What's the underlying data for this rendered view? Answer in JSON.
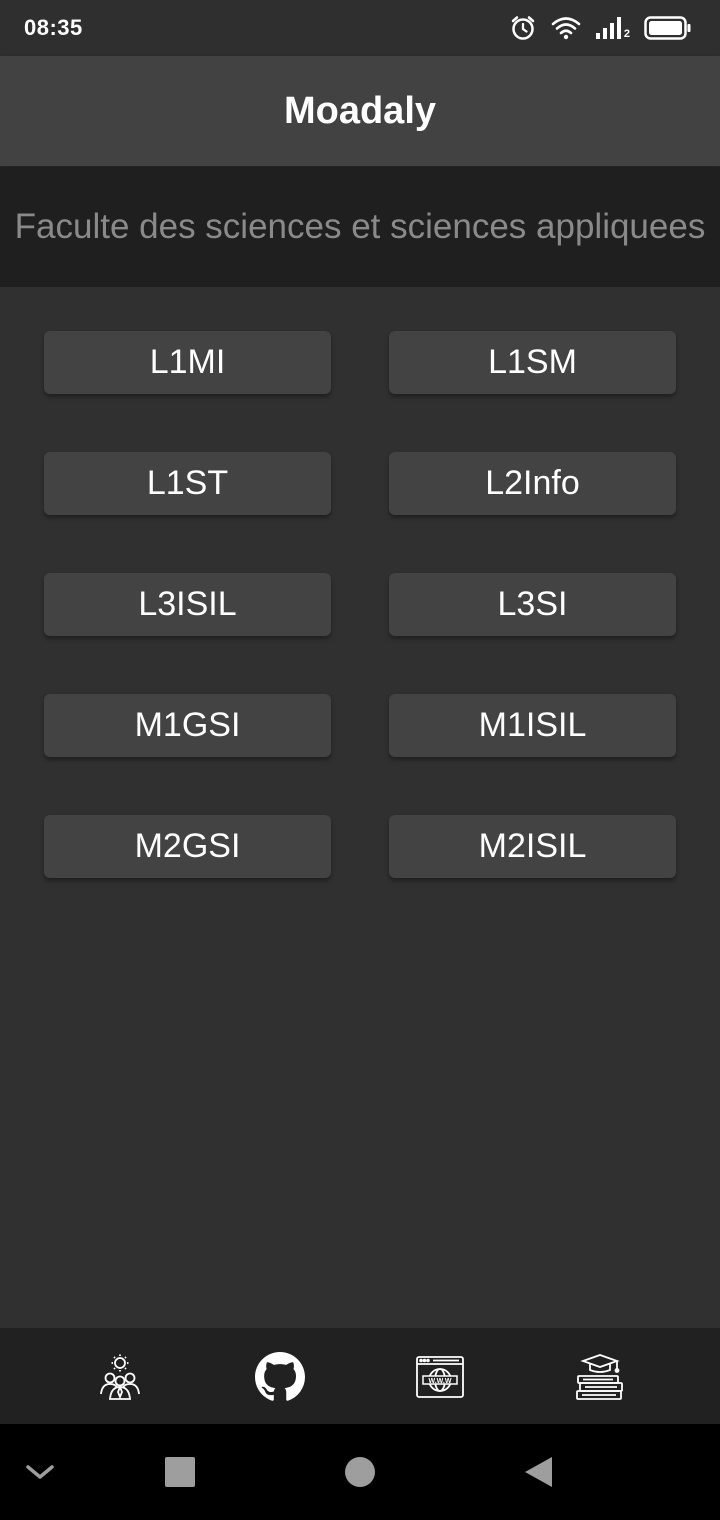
{
  "status_bar": {
    "time": "08:35",
    "signal_sub": "2",
    "icons": [
      "alarm-icon",
      "wifi-icon",
      "signal-icon",
      "battery-icon"
    ]
  },
  "app_bar": {
    "title": "Moadaly"
  },
  "faculty": {
    "name": "Faculte des sciences et sciences appliquees"
  },
  "levels": [
    "L1MI",
    "L1SM",
    "L1ST",
    "L2Info",
    "L3ISIL",
    "L3SI",
    "M1GSI",
    "M1ISIL",
    "M2GSI",
    "M2ISIL"
  ],
  "bottom_nav": {
    "items": [
      "team-icon",
      "github-icon",
      "website-icon",
      "graduation-books-icon"
    ]
  },
  "system_nav": {
    "items": [
      "chevron-down-icon",
      "recents-square-icon",
      "home-circle-icon",
      "back-triangle-icon"
    ]
  },
  "colors": {
    "background": "#303030",
    "app_bar": "#424242",
    "subtitle_band": "#1f1f1f",
    "subtitle_text": "#8a8a8a",
    "button": "#434343",
    "bottom_nav": "#212121",
    "system_nav": "#000000"
  }
}
